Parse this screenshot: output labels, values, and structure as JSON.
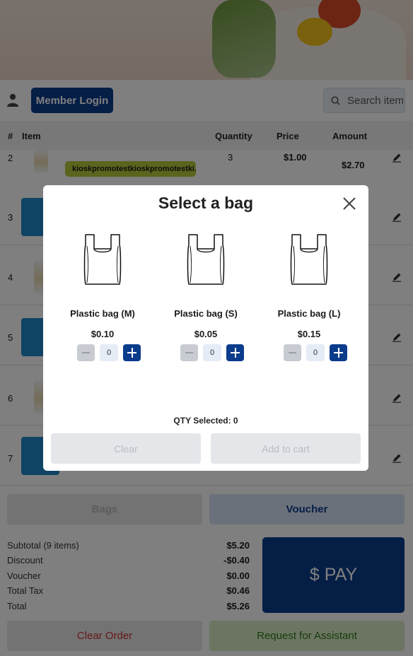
{
  "header": {
    "member_login_label": "Member Login",
    "search_placeholder": "Search item"
  },
  "table": {
    "columns": [
      "#",
      "Item",
      "Quantity",
      "Price",
      "Amount"
    ],
    "rows": [
      {
        "num": "2",
        "qty": "3",
        "price": "$1.00",
        "amount": "$2.70",
        "promo": "kioskpromotestkioskpromotestki..."
      },
      {
        "num": "3"
      },
      {
        "num": "4"
      },
      {
        "num": "5"
      },
      {
        "num": "6"
      },
      {
        "num": "7"
      }
    ]
  },
  "footer": {
    "bags_label": "Bags",
    "voucher_label": "Voucher",
    "pay_label": "$ PAY",
    "clear_order_label": "Clear Order",
    "assistant_label": "Request for Assistant",
    "summary": [
      {
        "label": "Subtotal (9 items)",
        "value": "$5.20"
      },
      {
        "label": "Discount",
        "value": "-$0.40"
      },
      {
        "label": "Voucher",
        "value": "$0.00"
      },
      {
        "label": "Total Tax",
        "value": "$0.46"
      },
      {
        "label": "Total",
        "value": "$5.26"
      }
    ]
  },
  "modal": {
    "title": "Select a bag",
    "bags": [
      {
        "name": "Plastic bag (M)",
        "price": "$0.10",
        "qty": "0"
      },
      {
        "name": "Plastic bag (S)",
        "price": "$0.05",
        "qty": "0"
      },
      {
        "name": "Plastic bag (L)",
        "price": "$0.15",
        "qty": "0"
      }
    ],
    "qty_selected_text": "QTY Selected: 0",
    "clear_label": "Clear",
    "add_to_cart_label": "Add to cart"
  },
  "colors": {
    "primary": "#0b3c8c",
    "promo": "#b9c93a",
    "danger": "#d03030",
    "success": "#2f7a1a"
  }
}
